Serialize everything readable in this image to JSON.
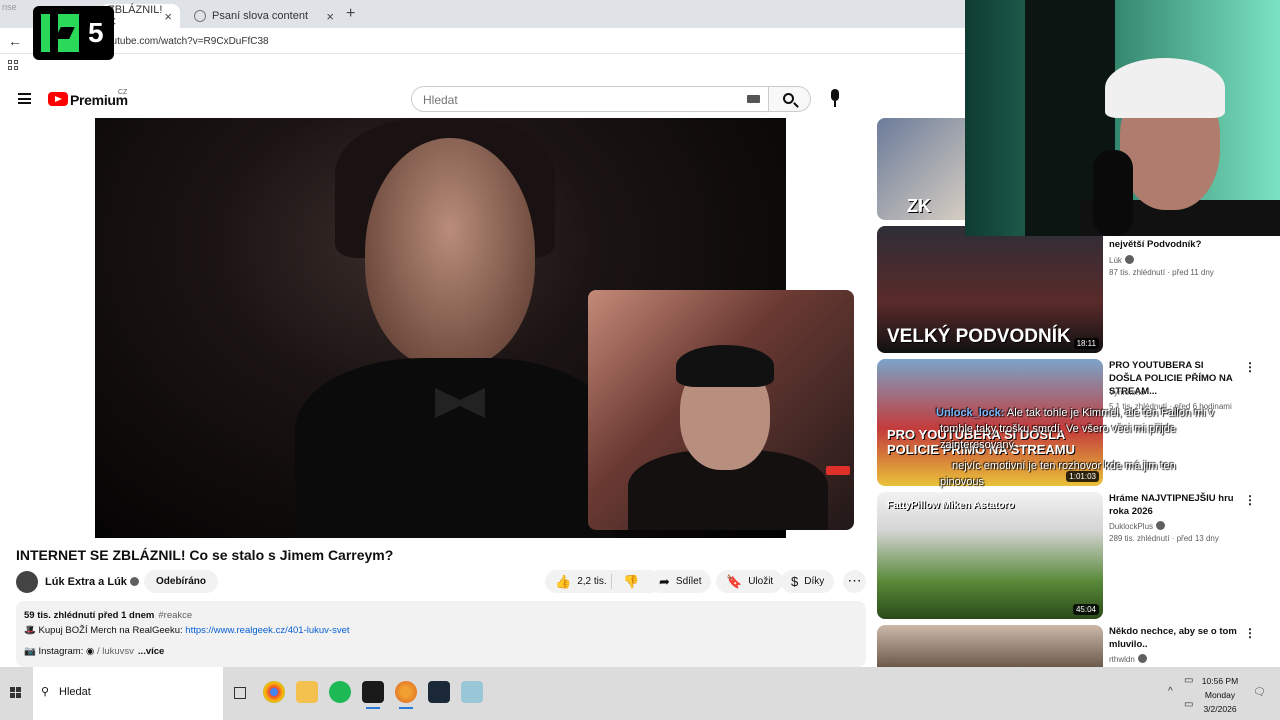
{
  "browser": {
    "tabs": [
      {
        "label": "ZBLÁZNIL! C",
        "active": true
      },
      {
        "label": "Psaní slova content",
        "active": false
      }
    ],
    "url": "outube.com/watch?v=R9CxDuFfC38",
    "corner_text": "nse"
  },
  "overlay_logo": {
    "text": "5"
  },
  "youtube": {
    "brand": "Premium",
    "country": "CZ",
    "search_placeholder": "Hledat"
  },
  "video": {
    "title": "INTERNET SE ZBLÁZNIL! Co se stalo s Jimem Carreym?",
    "channel": "Lúk Extra a Lúk",
    "subscribe_label": "Odebíráno",
    "likes": "2,2 tis.",
    "share_label": "Sdílet",
    "save_label": "Uložit",
    "thanks_label": "Díky",
    "description": {
      "stats": "59 tis. zhlédnutí  před 1 dnem",
      "hashtag": "#reakce",
      "merch_text": "Kupuj BOŽÍ Merch na RealGeeku:",
      "merch_link": "https://www.realgeek.cz/401-lukuv-svet",
      "instagram_label": "Instagram:",
      "instagram_handle": "/ lukuvsv",
      "more_label": "...více"
    }
  },
  "recommendations": [
    {
      "title": "",
      "channel": "",
      "meta": "",
      "duration": "",
      "thumb_text": "ZK"
    },
    {
      "title": "největší Podvodník?",
      "channel": "Lúk",
      "meta": "87 tis. zhlédnutí · před 11 dny",
      "duration": "18:11",
      "thumb_text": "VELKÝ PODVODNÍK"
    },
    {
      "title": "PRO YOUTUBERA SI DOŠLA POLICIE PŘÍMO NA STREAM...",
      "channel": "Vymeteno",
      "meta": "5,1 tis. zhlédnutí · před 6 hodinami",
      "duration": "1:01:03",
      "thumb_text": "PRO YOUTUBERA SI DOŠLA POLICIE PŘÍMO NA STREAMU"
    },
    {
      "title": "Hráme NAJVTIPNEJŠIU hru roka 2026",
      "channel": "DuklockPlus",
      "meta": "289 tis. zhlédnutí · před 13 dny",
      "duration": "45:04",
      "thumb_text": "FattyPillow Miken Astatoro"
    },
    {
      "title": "Někdo nechce, aby se o tom mluvilo..",
      "channel": "rthwldn",
      "meta": "",
      "duration": "",
      "thumb_text": ""
    }
  ],
  "chat": [
    {
      "user": "Unlock_lock:",
      "text": "Ale tak tohle je Kimmel, ale ten Fallon mi v"
    },
    {
      "user": "",
      "text": "tomhle taky trošku smrdí. Ve všero věci mi přijde"
    },
    {
      "user": "",
      "text": "zainteresovaný"
    },
    {
      "user": "",
      "text": "nejvíc emotivní je ten rozhovor kde má jim ten"
    },
    {
      "user": "",
      "text": "pinovous"
    }
  ],
  "taskbar": {
    "search_placeholder": "Hledat",
    "time": "10:56 PM",
    "day": "Monday",
    "date": "3/2/2026"
  },
  "colors": {
    "yt_red": "#ff0000",
    "k5_green": "#2bd95a",
    "link_blue": "#065fd4",
    "cam_teal": "#2a7a62"
  }
}
